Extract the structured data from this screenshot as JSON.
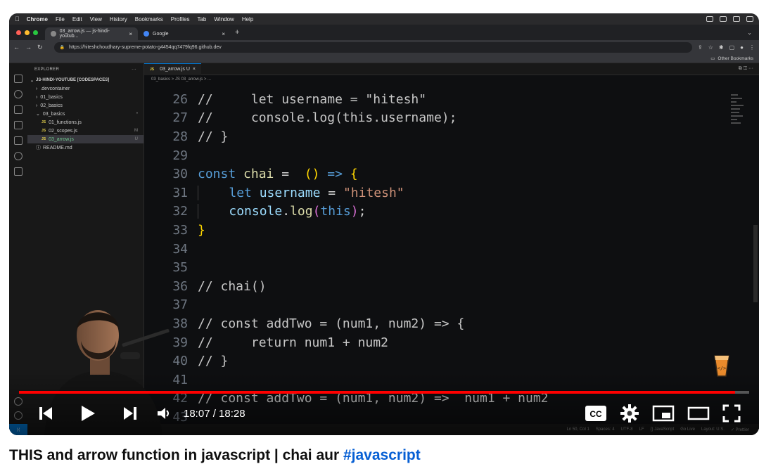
{
  "mac_menu": {
    "apple": "",
    "items": [
      "Chrome",
      "File",
      "Edit",
      "View",
      "History",
      "Bookmarks",
      "Profiles",
      "Tab",
      "Window",
      "Help"
    ]
  },
  "browser": {
    "tabs": [
      {
        "label": "03_arrow.js — js-hindi-youtub...",
        "close": "×",
        "active": true
      },
      {
        "label": "Google",
        "close": "×",
        "active": false
      }
    ],
    "new_tab": "+",
    "url": "https://hiteshchoudhary-supreme-potato-g4454qq7479fq96.github.dev",
    "bookmarks_label": "Other Bookmarks"
  },
  "vscode": {
    "explorer_title": "EXPLORER",
    "explorer_more": "···",
    "project": "JS-HINDI-YOUTUBE [CODESPACES]",
    "tree": [
      {
        "label": ".devcontainer",
        "indent": 1,
        "type": "folder",
        "badge": "",
        "selected": false
      },
      {
        "label": "01_basics",
        "indent": 1,
        "type": "folder",
        "badge": "",
        "selected": false
      },
      {
        "label": "02_basics",
        "indent": 1,
        "type": "folder",
        "badge": "",
        "selected": false
      },
      {
        "label": "03_basics",
        "indent": 1,
        "type": "folder-open",
        "badge": "•",
        "selected": false
      },
      {
        "label": "01_functions.js",
        "indent": 2,
        "type": "js",
        "badge": "",
        "selected": false
      },
      {
        "label": "02_scopes.js",
        "indent": 2,
        "type": "js",
        "badge": "M",
        "selected": false
      },
      {
        "label": "03_arrow.js",
        "indent": 2,
        "type": "js",
        "badge": "U",
        "selected": true
      },
      {
        "label": "README.md",
        "indent": 1,
        "type": "info",
        "badge": "",
        "selected": false
      }
    ],
    "editor_tab": "03_arrow.js U",
    "breadcrumb": "03_basics > JS 03_arrow.js > ...",
    "status": [
      "Ln 50, Col 1",
      "Spaces: 4",
      "UTF-8",
      "LF",
      "{} JavaScript",
      "Go Live",
      "Layout: U.S.",
      "✓ Prettier"
    ],
    "code_lines": [
      {
        "n": "26",
        "tokens": [
          [
            "cm",
            "//     let username = \"hitesh\""
          ]
        ]
      },
      {
        "n": "27",
        "tokens": [
          [
            "cm",
            "//     console.log(this.username);"
          ]
        ]
      },
      {
        "n": "28",
        "tokens": [
          [
            "cm",
            "// }"
          ]
        ]
      },
      {
        "n": "29",
        "tokens": []
      },
      {
        "n": "30",
        "tokens": [
          [
            "kw",
            "const "
          ],
          [
            "fn",
            "chai"
          ],
          [
            "txt",
            " =  "
          ],
          [
            "br",
            "()"
          ],
          [
            "kw",
            " => "
          ],
          [
            "br",
            "{"
          ]
        ]
      },
      {
        "n": "31",
        "tokens": [
          [
            "guide",
            "    "
          ],
          [
            "kw",
            "let "
          ],
          [
            "vr",
            "username"
          ],
          [
            "txt",
            " = "
          ],
          [
            "st",
            "\"hitesh\""
          ]
        ]
      },
      {
        "n": "32",
        "tokens": [
          [
            "guide",
            "    "
          ],
          [
            "vr",
            "console"
          ],
          [
            "txt",
            "."
          ],
          [
            "fn",
            "log"
          ],
          [
            "br2",
            "("
          ],
          [
            "th",
            "this"
          ],
          [
            "br2",
            ")"
          ],
          [
            "txt",
            ";"
          ]
        ]
      },
      {
        "n": "33",
        "tokens": [
          [
            "br",
            "}"
          ]
        ]
      },
      {
        "n": "34",
        "tokens": []
      },
      {
        "n": "35",
        "tokens": []
      },
      {
        "n": "36",
        "tokens": [
          [
            "cm",
            "// chai()"
          ]
        ]
      },
      {
        "n": "37",
        "tokens": []
      },
      {
        "n": "38",
        "tokens": [
          [
            "cm",
            "// const addTwo = (num1, num2) => {"
          ]
        ]
      },
      {
        "n": "39",
        "tokens": [
          [
            "cm",
            "//     return num1 + num2"
          ]
        ]
      },
      {
        "n": "40",
        "tokens": [
          [
            "cm",
            "// }"
          ]
        ]
      },
      {
        "n": "41",
        "tokens": []
      },
      {
        "n": "42",
        "tokens": [
          [
            "cm",
            "// const addTwo = (num1, num2) =>  num1 + num2"
          ]
        ]
      },
      {
        "n": "43",
        "tokens": []
      }
    ]
  },
  "player": {
    "current_time": "18:07",
    "duration": "18:28",
    "time_display": "18:07 / 18:28",
    "progress_fraction": 0.981,
    "cc_label": "CC",
    "played_color": "#ff0000"
  },
  "video_title": {
    "text": "THIS and arrow function in javascript | chai aur ",
    "hashtag": "#javascript"
  }
}
